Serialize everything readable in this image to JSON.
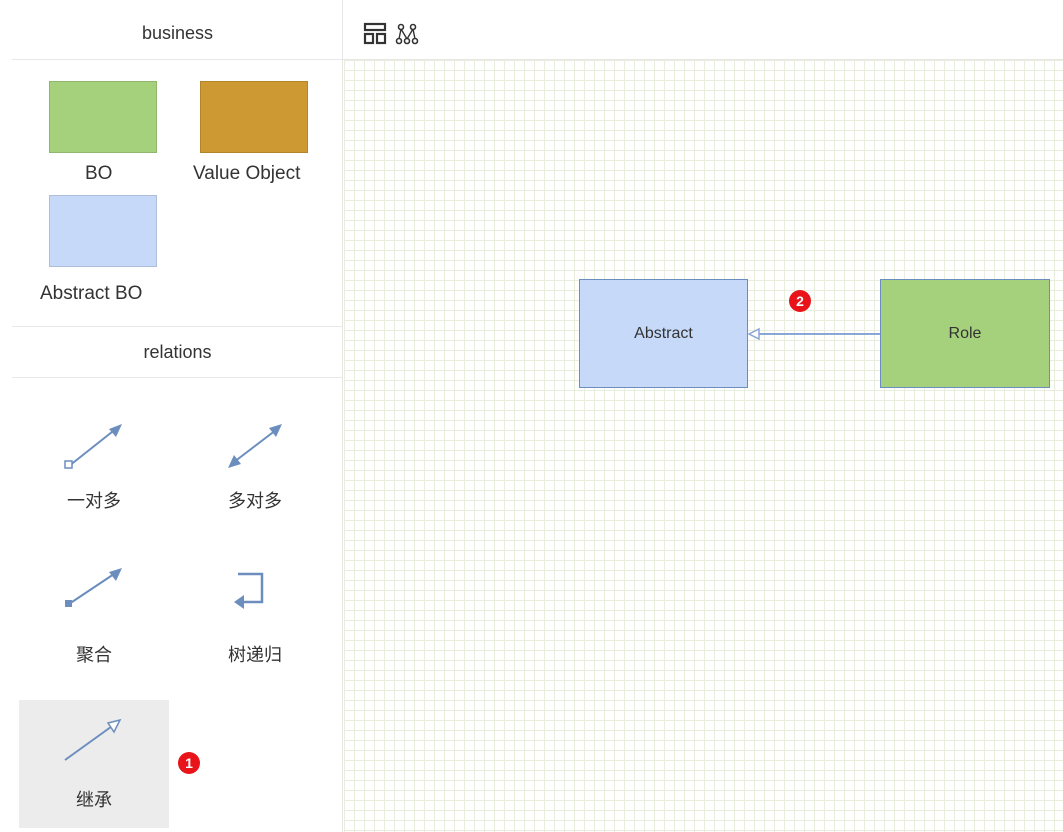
{
  "sidebar": {
    "business_header": "business",
    "business_items": [
      {
        "label": "BO",
        "color": "#a5d17c"
      },
      {
        "label": "Value Object",
        "color": "#cc9933"
      },
      {
        "label": "Abstract BO",
        "color": "#c6d9f9"
      }
    ],
    "relations_header": "relations",
    "relation_items": [
      {
        "label": "一对多",
        "icon": "one-to-many-arrow-icon"
      },
      {
        "label": "多对多",
        "icon": "many-to-many-arrow-icon"
      },
      {
        "label": "聚合",
        "icon": "aggregation-arrow-icon"
      },
      {
        "label": "树递归",
        "icon": "tree-recursion-arrow-icon"
      },
      {
        "label": "继承",
        "icon": "inheritance-arrow-icon",
        "selected": true
      }
    ]
  },
  "toolbar": {
    "buttons": [
      "layout-icon",
      "graph-icon"
    ]
  },
  "canvas": {
    "nodes": [
      {
        "label": "Abstract",
        "fill": "#c6d9f9",
        "stroke": "#6c8ebf"
      },
      {
        "label": "Role",
        "fill": "#a5d17c",
        "stroke": "#6c8ebf"
      }
    ],
    "edge": {
      "from": "Role",
      "to": "Abstract",
      "type": "inheritance"
    }
  },
  "markers": [
    "1",
    "2"
  ]
}
